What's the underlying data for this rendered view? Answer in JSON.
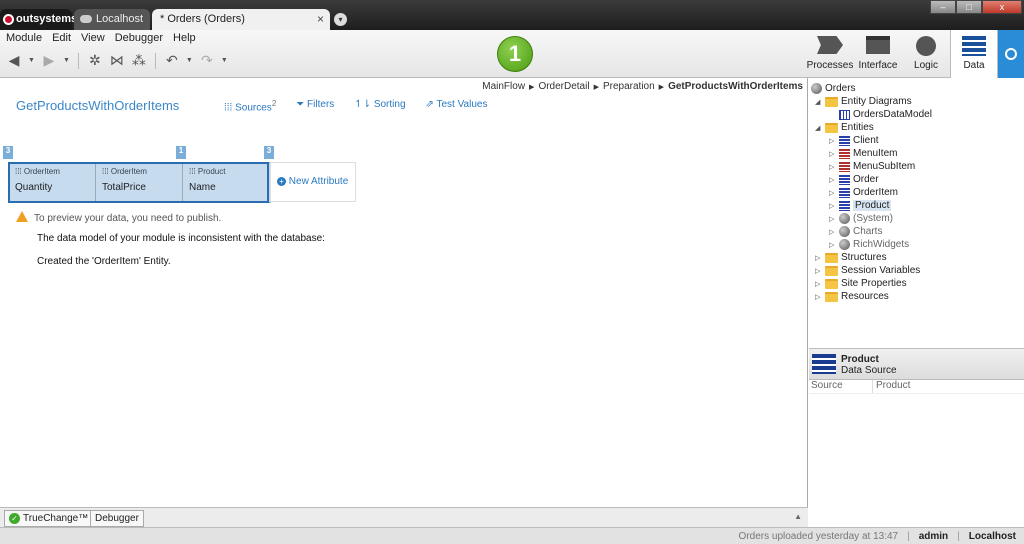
{
  "window": {
    "tabs": [
      {
        "label": "outsystems"
      },
      {
        "label": "Localhost"
      },
      {
        "label": "* Orders (Orders)"
      }
    ],
    "tab_close": "×",
    "tab_more": "▾",
    "controls": {
      "minimize": "–",
      "maximize": "□",
      "close": "x"
    }
  },
  "menu": [
    "Module",
    "Edit",
    "View",
    "Debugger",
    "Help"
  ],
  "publish_badge": "1",
  "mode_tabs": [
    {
      "label": "Processes",
      "icon": "processes-icon"
    },
    {
      "label": "Interface",
      "icon": "interface-icon"
    },
    {
      "label": "Logic",
      "icon": "logic-icon"
    },
    {
      "label": "Data",
      "icon": "data-icon",
      "active": true
    }
  ],
  "breadcrumb": [
    "MainFlow",
    "OrderDetail",
    "Preparation",
    "GetProductsWithOrderItems"
  ],
  "query": {
    "title": "GetProductsWithOrderItems",
    "tabs": {
      "sources": "Sources",
      "sources_count": "2",
      "filters": "Filters",
      "sorting": "Sorting",
      "test_values": "Test Values"
    },
    "markers": [
      "3",
      "1",
      "3"
    ],
    "columns": [
      {
        "entity": "OrderItem",
        "attribute": "Quantity"
      },
      {
        "entity": "OrderItem",
        "attribute": "TotalPrice"
      },
      {
        "entity": "Product",
        "attribute": "Name"
      }
    ],
    "new_attribute": "New Attribute",
    "warning": "To preview your data, you need to publish.",
    "messages": [
      "The data model of your module is inconsistent with the database:",
      "Created the 'OrderItem' Entity."
    ]
  },
  "bottom_tabs": [
    "TrueChange™",
    "Debugger"
  ],
  "status": {
    "message": "Orders uploaded yesterday at 13:47",
    "user": "admin",
    "server": "Localhost"
  },
  "tree": {
    "root": "Orders",
    "entity_diagrams": "Entity Diagrams",
    "diagram": "OrdersDataModel",
    "entities": "Entities",
    "entity_items": [
      "Client",
      "MenuItem",
      "MenuSubItem",
      "Order",
      "OrderItem",
      "Product"
    ],
    "references": [
      "(System)",
      "Charts",
      "RichWidgets"
    ],
    "folders": [
      "Structures",
      "Session Variables",
      "Site Properties",
      "Resources"
    ]
  },
  "properties": {
    "title": "Product",
    "subtitle": "Data Source",
    "rows": [
      {
        "name": "Source",
        "value": "Product"
      }
    ]
  }
}
